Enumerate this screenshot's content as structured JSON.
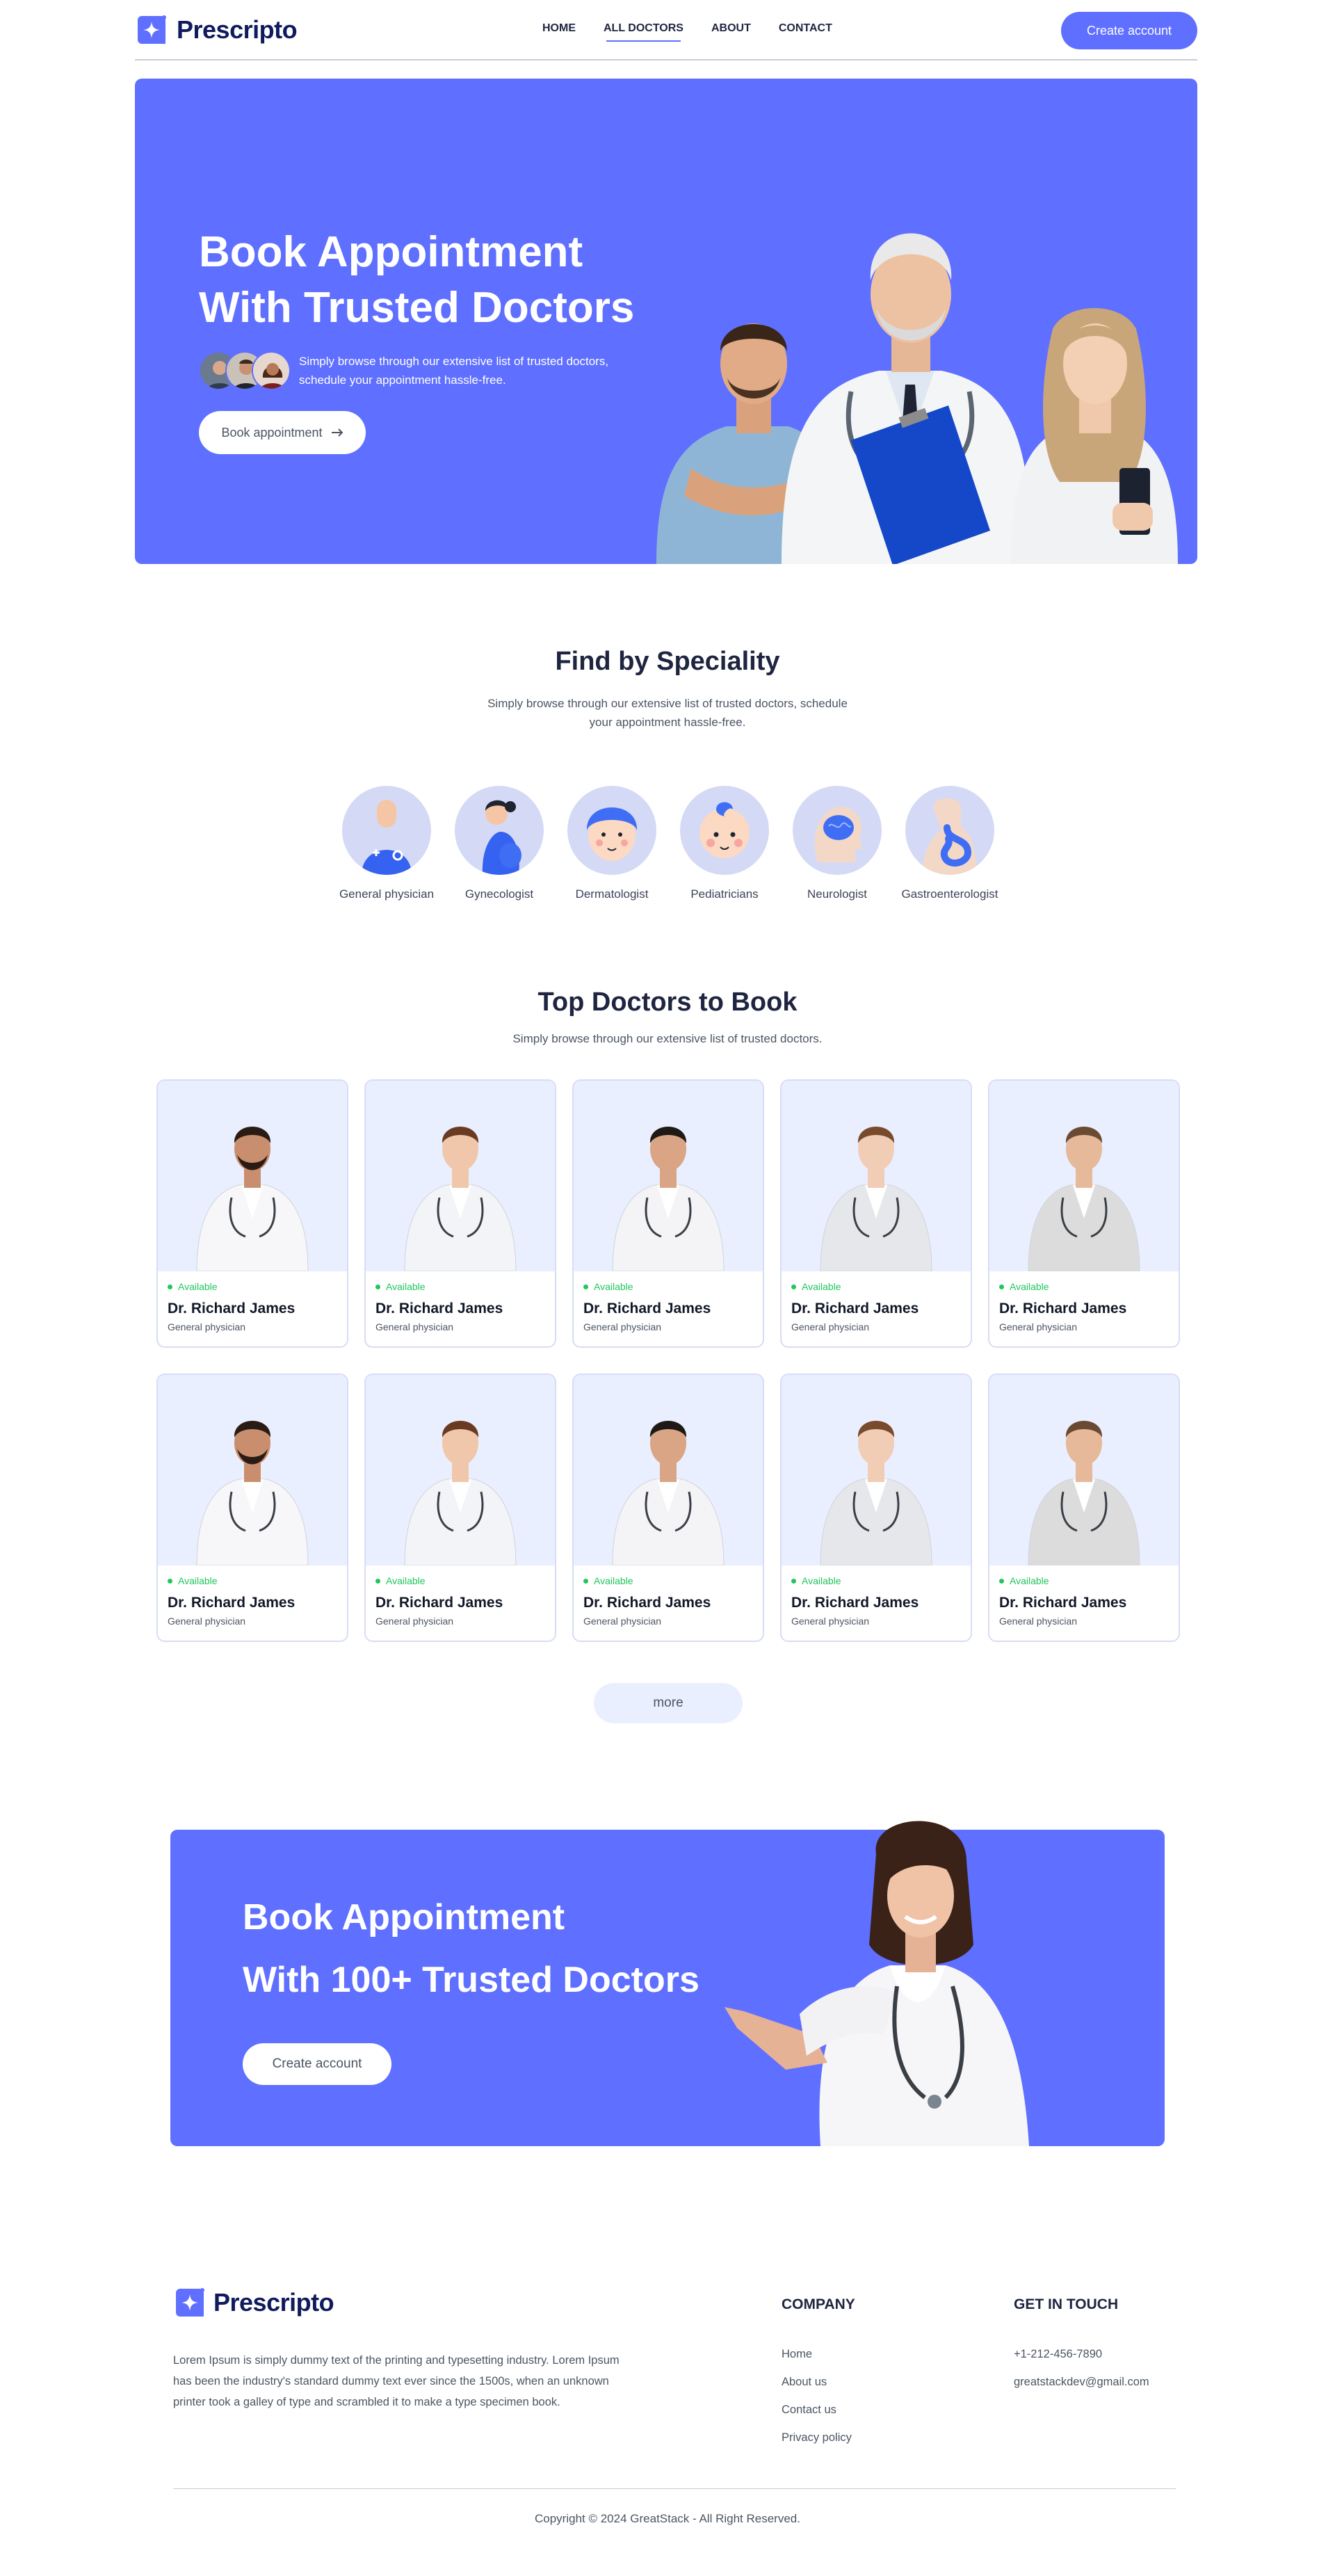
{
  "brand": {
    "name": "Prescripto",
    "accent": "#5F6FFF"
  },
  "nav": {
    "links": [
      "HOME",
      "ALL DOCTORS",
      "ABOUT",
      "CONTACT"
    ],
    "active": "ALL DOCTORS",
    "cta": "Create account"
  },
  "hero": {
    "title_line1": "Book Appointment",
    "title_line2": "With Trusted Doctors",
    "subtitle_line1": "Simply browse through our extensive list of trusted doctors,",
    "subtitle_line2": "schedule your appointment hassle-free.",
    "button": "Book appointment",
    "button_icon": "arrow-right-icon"
  },
  "speciality": {
    "title": "Find by Speciality",
    "subtitle_line1": "Simply browse through our extensive list of trusted doctors, schedule",
    "subtitle_line2": "your appointment hassle-free.",
    "items": [
      {
        "label": "General physician",
        "icon": "general-physician-icon"
      },
      {
        "label": "Gynecologist",
        "icon": "gynecologist-icon"
      },
      {
        "label": "Dermatologist",
        "icon": "dermatologist-icon"
      },
      {
        "label": "Pediatricians",
        "icon": "pediatrician-icon"
      },
      {
        "label": "Neurologist",
        "icon": "neurologist-icon"
      },
      {
        "label": "Gastroenterologist",
        "icon": "gastroenterologist-icon"
      }
    ]
  },
  "doctors": {
    "title": "Top Doctors to Book",
    "subtitle": "Simply browse through our extensive list of trusted doctors.",
    "cards": [
      {
        "status": "Available",
        "name": "Dr. Richard James",
        "speciality": "General physician"
      },
      {
        "status": "Available",
        "name": "Dr. Richard James",
        "speciality": "General physician"
      },
      {
        "status": "Available",
        "name": "Dr. Richard James",
        "speciality": "General physician"
      },
      {
        "status": "Available",
        "name": "Dr. Richard James",
        "speciality": "General physician"
      },
      {
        "status": "Available",
        "name": "Dr. Richard James",
        "speciality": "General physician"
      },
      {
        "status": "Available",
        "name": "Dr. Richard James",
        "speciality": "General physician"
      },
      {
        "status": "Available",
        "name": "Dr. Richard James",
        "speciality": "General physician"
      },
      {
        "status": "Available",
        "name": "Dr. Richard James",
        "speciality": "General physician"
      },
      {
        "status": "Available",
        "name": "Dr. Richard James",
        "speciality": "General physician"
      },
      {
        "status": "Available",
        "name": "Dr. Richard James",
        "speciality": "General physician"
      }
    ],
    "more_button": "more"
  },
  "banner": {
    "line1": "Book Appointment",
    "line2": "With 100+ Trusted Doctors",
    "button": "Create account"
  },
  "footer": {
    "about": "Lorem Ipsum is simply dummy text of the printing and typesetting industry. Lorem Ipsum has been the industry's standard dummy text ever since the 1500s, when an unknown printer took a galley of type and scrambled it to make a type specimen book.",
    "company_heading": "COMPANY",
    "company_links": [
      "Home",
      "About us",
      "Contact us",
      "Privacy policy"
    ],
    "contact_heading": "GET IN TOUCH",
    "phone": "+1-212-456-7890",
    "email": "greatstackdev@gmail.com",
    "copyright": "Copyright © 2024 GreatStack - All Right Reserved."
  }
}
